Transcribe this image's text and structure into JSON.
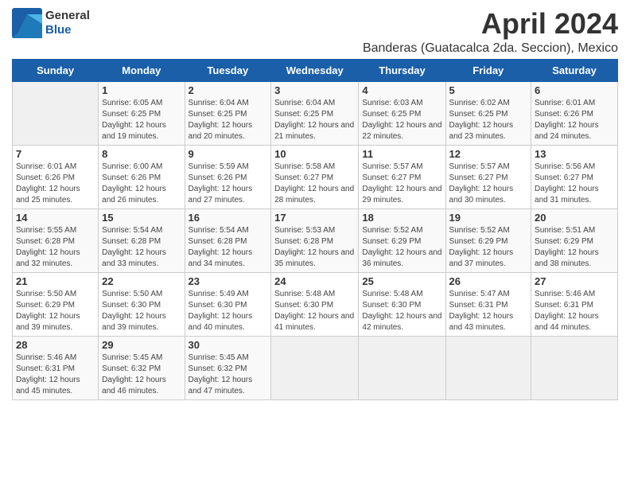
{
  "header": {
    "logo_line1": "General",
    "logo_line2": "Blue",
    "title": "April 2024",
    "subtitle": "Banderas (Guatacalca 2da. Seccion), Mexico"
  },
  "weekdays": [
    "Sunday",
    "Monday",
    "Tuesday",
    "Wednesday",
    "Thursday",
    "Friday",
    "Saturday"
  ],
  "weeks": [
    [
      {
        "day": "",
        "sunrise": "",
        "sunset": "",
        "daylight": ""
      },
      {
        "day": "1",
        "sunrise": "Sunrise: 6:05 AM",
        "sunset": "Sunset: 6:25 PM",
        "daylight": "Daylight: 12 hours and 19 minutes."
      },
      {
        "day": "2",
        "sunrise": "Sunrise: 6:04 AM",
        "sunset": "Sunset: 6:25 PM",
        "daylight": "Daylight: 12 hours and 20 minutes."
      },
      {
        "day": "3",
        "sunrise": "Sunrise: 6:04 AM",
        "sunset": "Sunset: 6:25 PM",
        "daylight": "Daylight: 12 hours and 21 minutes."
      },
      {
        "day": "4",
        "sunrise": "Sunrise: 6:03 AM",
        "sunset": "Sunset: 6:25 PM",
        "daylight": "Daylight: 12 hours and 22 minutes."
      },
      {
        "day": "5",
        "sunrise": "Sunrise: 6:02 AM",
        "sunset": "Sunset: 6:25 PM",
        "daylight": "Daylight: 12 hours and 23 minutes."
      },
      {
        "day": "6",
        "sunrise": "Sunrise: 6:01 AM",
        "sunset": "Sunset: 6:26 PM",
        "daylight": "Daylight: 12 hours and 24 minutes."
      }
    ],
    [
      {
        "day": "7",
        "sunrise": "Sunrise: 6:01 AM",
        "sunset": "Sunset: 6:26 PM",
        "daylight": "Daylight: 12 hours and 25 minutes."
      },
      {
        "day": "8",
        "sunrise": "Sunrise: 6:00 AM",
        "sunset": "Sunset: 6:26 PM",
        "daylight": "Daylight: 12 hours and 26 minutes."
      },
      {
        "day": "9",
        "sunrise": "Sunrise: 5:59 AM",
        "sunset": "Sunset: 6:26 PM",
        "daylight": "Daylight: 12 hours and 27 minutes."
      },
      {
        "day": "10",
        "sunrise": "Sunrise: 5:58 AM",
        "sunset": "Sunset: 6:27 PM",
        "daylight": "Daylight: 12 hours and 28 minutes."
      },
      {
        "day": "11",
        "sunrise": "Sunrise: 5:57 AM",
        "sunset": "Sunset: 6:27 PM",
        "daylight": "Daylight: 12 hours and 29 minutes."
      },
      {
        "day": "12",
        "sunrise": "Sunrise: 5:57 AM",
        "sunset": "Sunset: 6:27 PM",
        "daylight": "Daylight: 12 hours and 30 minutes."
      },
      {
        "day": "13",
        "sunrise": "Sunrise: 5:56 AM",
        "sunset": "Sunset: 6:27 PM",
        "daylight": "Daylight: 12 hours and 31 minutes."
      }
    ],
    [
      {
        "day": "14",
        "sunrise": "Sunrise: 5:55 AM",
        "sunset": "Sunset: 6:28 PM",
        "daylight": "Daylight: 12 hours and 32 minutes."
      },
      {
        "day": "15",
        "sunrise": "Sunrise: 5:54 AM",
        "sunset": "Sunset: 6:28 PM",
        "daylight": "Daylight: 12 hours and 33 minutes."
      },
      {
        "day": "16",
        "sunrise": "Sunrise: 5:54 AM",
        "sunset": "Sunset: 6:28 PM",
        "daylight": "Daylight: 12 hours and 34 minutes."
      },
      {
        "day": "17",
        "sunrise": "Sunrise: 5:53 AM",
        "sunset": "Sunset: 6:28 PM",
        "daylight": "Daylight: 12 hours and 35 minutes."
      },
      {
        "day": "18",
        "sunrise": "Sunrise: 5:52 AM",
        "sunset": "Sunset: 6:29 PM",
        "daylight": "Daylight: 12 hours and 36 minutes."
      },
      {
        "day": "19",
        "sunrise": "Sunrise: 5:52 AM",
        "sunset": "Sunset: 6:29 PM",
        "daylight": "Daylight: 12 hours and 37 minutes."
      },
      {
        "day": "20",
        "sunrise": "Sunrise: 5:51 AM",
        "sunset": "Sunset: 6:29 PM",
        "daylight": "Daylight: 12 hours and 38 minutes."
      }
    ],
    [
      {
        "day": "21",
        "sunrise": "Sunrise: 5:50 AM",
        "sunset": "Sunset: 6:29 PM",
        "daylight": "Daylight: 12 hours and 39 minutes."
      },
      {
        "day": "22",
        "sunrise": "Sunrise: 5:50 AM",
        "sunset": "Sunset: 6:30 PM",
        "daylight": "Daylight: 12 hours and 39 minutes."
      },
      {
        "day": "23",
        "sunrise": "Sunrise: 5:49 AM",
        "sunset": "Sunset: 6:30 PM",
        "daylight": "Daylight: 12 hours and 40 minutes."
      },
      {
        "day": "24",
        "sunrise": "Sunrise: 5:48 AM",
        "sunset": "Sunset: 6:30 PM",
        "daylight": "Daylight: 12 hours and 41 minutes."
      },
      {
        "day": "25",
        "sunrise": "Sunrise: 5:48 AM",
        "sunset": "Sunset: 6:30 PM",
        "daylight": "Daylight: 12 hours and 42 minutes."
      },
      {
        "day": "26",
        "sunrise": "Sunrise: 5:47 AM",
        "sunset": "Sunset: 6:31 PM",
        "daylight": "Daylight: 12 hours and 43 minutes."
      },
      {
        "day": "27",
        "sunrise": "Sunrise: 5:46 AM",
        "sunset": "Sunset: 6:31 PM",
        "daylight": "Daylight: 12 hours and 44 minutes."
      }
    ],
    [
      {
        "day": "28",
        "sunrise": "Sunrise: 5:46 AM",
        "sunset": "Sunset: 6:31 PM",
        "daylight": "Daylight: 12 hours and 45 minutes."
      },
      {
        "day": "29",
        "sunrise": "Sunrise: 5:45 AM",
        "sunset": "Sunset: 6:32 PM",
        "daylight": "Daylight: 12 hours and 46 minutes."
      },
      {
        "day": "30",
        "sunrise": "Sunrise: 5:45 AM",
        "sunset": "Sunset: 6:32 PM",
        "daylight": "Daylight: 12 hours and 47 minutes."
      },
      {
        "day": "",
        "sunrise": "",
        "sunset": "",
        "daylight": ""
      },
      {
        "day": "",
        "sunrise": "",
        "sunset": "",
        "daylight": ""
      },
      {
        "day": "",
        "sunrise": "",
        "sunset": "",
        "daylight": ""
      },
      {
        "day": "",
        "sunrise": "",
        "sunset": "",
        "daylight": ""
      }
    ]
  ]
}
